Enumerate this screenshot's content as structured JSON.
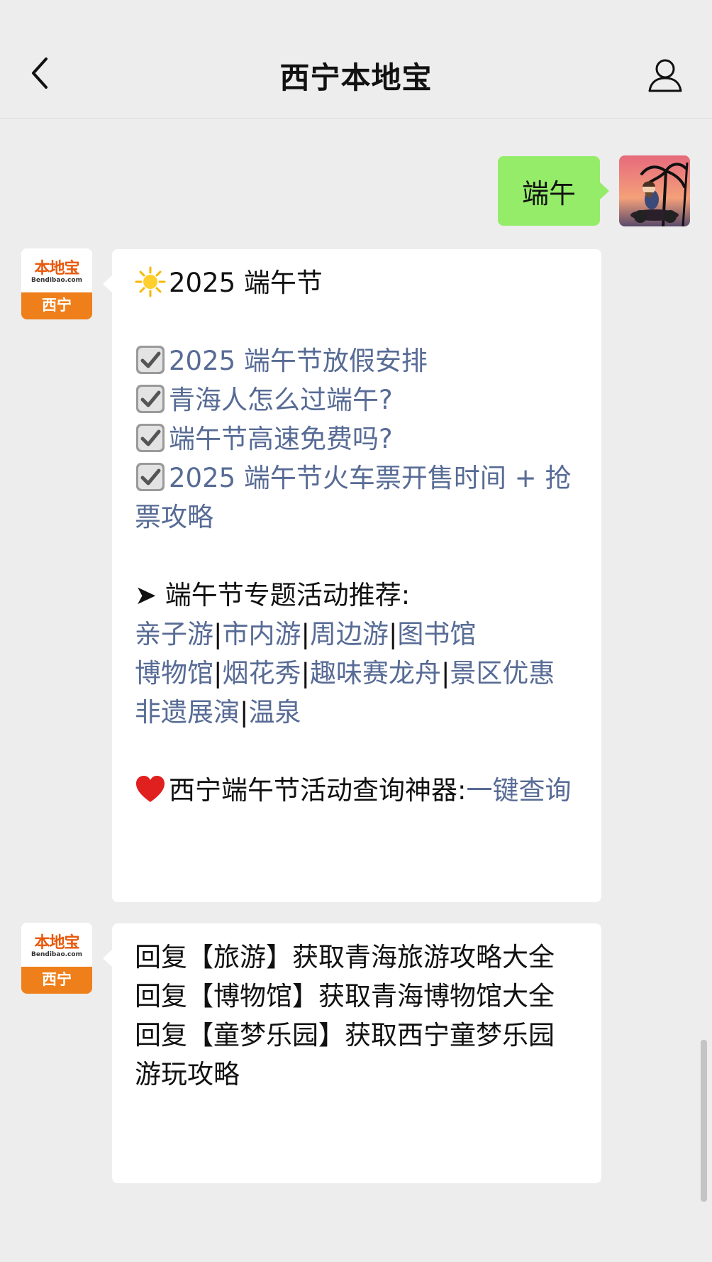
{
  "header": {
    "title": "西宁本地宝",
    "back_icon": "chevron-left-icon",
    "profile_icon": "person-icon"
  },
  "user_message": {
    "text": "端午",
    "bubble_color": "#95ec69"
  },
  "bot_avatar": {
    "logo_text": "本地宝",
    "logo_url": "Bendibao.com",
    "city": "西宁",
    "brand_color": "#ef7f1a"
  },
  "message1": {
    "title": "2025 端午节",
    "checklist": [
      "2025 端午节放假安排",
      "青海人怎么过端午?",
      "端午节高速免费吗?",
      "2025 端午节火车票开售时间 + 抢票攻略"
    ],
    "topic_heading": "➤ 端午节专题活动推荐:",
    "topics_row1": [
      "亲子游",
      "市内游",
      "周边游",
      "图书馆"
    ],
    "topics_row2": [
      "博物馆",
      "烟花秀",
      "趣味赛龙舟",
      "景区优惠"
    ],
    "topics_row3": [
      "非遗展演",
      "温泉"
    ],
    "separator": "|",
    "query_label": "西宁端午节活动查询神器:",
    "query_link": "一键查询",
    "link_color": "#576b95"
  },
  "message2": {
    "lines": [
      "回复【旅游】获取青海旅游攻略大全",
      "回复【博物馆】获取青海博物馆大全",
      "回复【童梦乐园】获取西宁童梦乐园游玩攻略"
    ]
  }
}
